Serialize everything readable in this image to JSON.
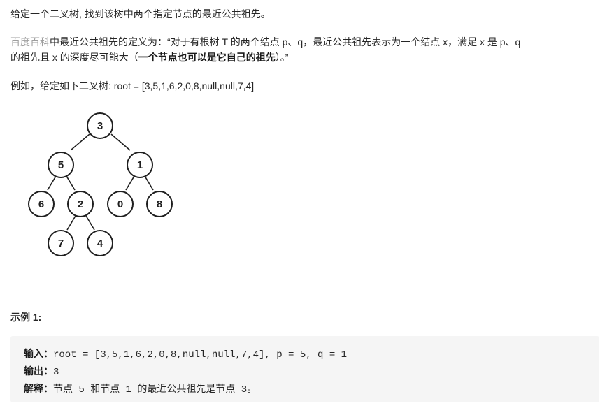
{
  "intro": "给定一个二叉树, 找到该树中两个指定节点的最近公共祖先。",
  "definition": {
    "link": "百度百科",
    "line1_rest": "中最近公共祖先的定义为：“对于有根树 T 的两个结点 p、q，最近公共祖先表示为一个结点 x，满足 x 是 p、q",
    "line2_pre": "的祖先且 x 的深度尽可能大（",
    "line2_bold": "一个节点也可以是它自己的祖先",
    "line2_post": "）。”"
  },
  "example_intro": "例如，给定如下二叉树:  root = [3,5,1,6,2,0,8,null,null,7,4]",
  "tree": {
    "nodes": [
      {
        "id": "n3",
        "label": "3"
      },
      {
        "id": "n5",
        "label": "5"
      },
      {
        "id": "n1",
        "label": "1"
      },
      {
        "id": "n6",
        "label": "6"
      },
      {
        "id": "n2",
        "label": "2"
      },
      {
        "id": "n0",
        "label": "0"
      },
      {
        "id": "n8",
        "label": "8"
      },
      {
        "id": "n7",
        "label": "7"
      },
      {
        "id": "n4",
        "label": "4"
      }
    ]
  },
  "example": {
    "heading": "示例 1:",
    "input_label": "输入：",
    "input_value": "root = [3,5,1,6,2,0,8,null,null,7,4], p = 5, q = 1",
    "output_label": "输出：",
    "output_value": "3",
    "explain_label": "解释：",
    "explain_value": "节点 5 和节点 1 的最近公共祖先是节点 3。"
  }
}
